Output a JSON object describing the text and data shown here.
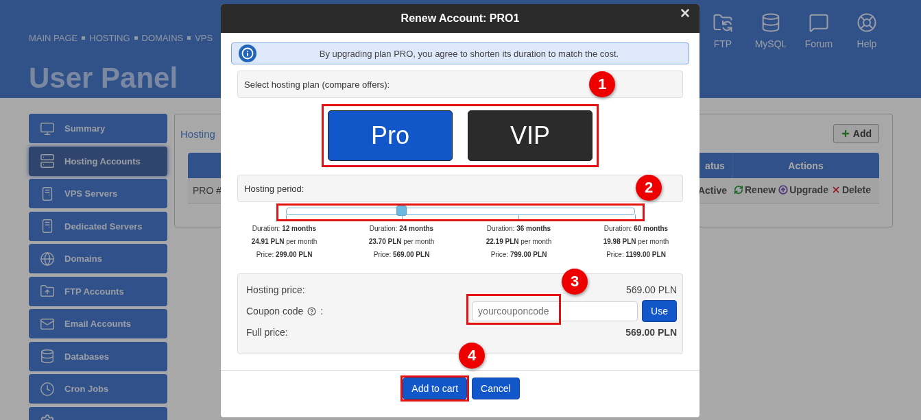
{
  "header": {
    "nav": [
      "MAIN PAGE",
      "HOSTING",
      "DOMAINS",
      "VPS"
    ],
    "shortcuts": [
      {
        "label": "FTP",
        "kind": "ftp"
      },
      {
        "label": "MySQL",
        "kind": "mysql"
      },
      {
        "label": "Forum",
        "kind": "forum"
      },
      {
        "label": "Help",
        "kind": "help"
      }
    ],
    "title": "User Panel"
  },
  "sidebar": {
    "items": [
      {
        "label": "Summary",
        "kind": "summary",
        "selected": false
      },
      {
        "label": "Hosting Accounts",
        "kind": "hosting",
        "selected": true
      },
      {
        "label": "VPS Servers",
        "kind": "vps",
        "selected": false
      },
      {
        "label": "Dedicated Servers",
        "kind": "dedicated",
        "selected": false
      },
      {
        "label": "Domains",
        "kind": "domains",
        "selected": false
      },
      {
        "label": "FTP Accounts",
        "kind": "ftp",
        "selected": false
      },
      {
        "label": "Email Accounts",
        "kind": "email",
        "selected": false
      },
      {
        "label": "Databases",
        "kind": "databases",
        "selected": false
      },
      {
        "label": "Cron Jobs",
        "kind": "cron",
        "selected": false
      }
    ]
  },
  "content": {
    "title": "Hosting",
    "add_button": "Add",
    "table": {
      "columns": [
        "atus",
        "Actions"
      ],
      "rows": [
        {
          "name": "PRO #",
          "status": "Active",
          "actions": [
            {
              "label": "Renew",
              "kind": "renew"
            },
            {
              "label": "Upgrade",
              "kind": "upgrade"
            },
            {
              "label": "Delete",
              "kind": "delete"
            }
          ]
        }
      ]
    }
  },
  "modal": {
    "title": "Renew Account: PRO1",
    "notice": "By upgrading plan PRO, you agree to shorten its duration to match the cost.",
    "plan_label": "Select hosting plan (compare offers):",
    "plans": [
      {
        "label": "Pro",
        "selected": true
      },
      {
        "label": "VIP",
        "selected": false
      }
    ],
    "period_label": "Hosting period:",
    "period_slider": {
      "level": 0.333
    },
    "periods": [
      {
        "duration": "Duration: **12 months**",
        "monthly": "**24.91 PLN** per month",
        "price": "Price: **299.00 PLN**"
      },
      {
        "duration": "Duration: **24 months**",
        "monthly": "**23.70 PLN** per month",
        "price": "Price: **569.00 PLN**"
      },
      {
        "duration": "Duration: **36 months**",
        "monthly": "**22.19 PLN** per month",
        "price": "Price: **799.00 PLN**"
      },
      {
        "duration": "Duration: **60 months**",
        "monthly": "**19.98 PLN** per month",
        "price": "Price: **1199.00 PLN**"
      }
    ],
    "summary": {
      "hosting_price_label": "Hosting price:",
      "hosting_price": "569.00 PLN",
      "coupon_label": "Coupon code",
      "coupon_colon": ":",
      "coupon_placeholder": "yourcouponcode",
      "use_button": "Use",
      "full_price_label": "Full price:",
      "full_price": "569.00 PLN"
    },
    "buttons": {
      "add_to_cart": "Add to cart",
      "cancel": "Cancel"
    },
    "markers": [
      "1",
      "2",
      "3",
      "4"
    ]
  }
}
